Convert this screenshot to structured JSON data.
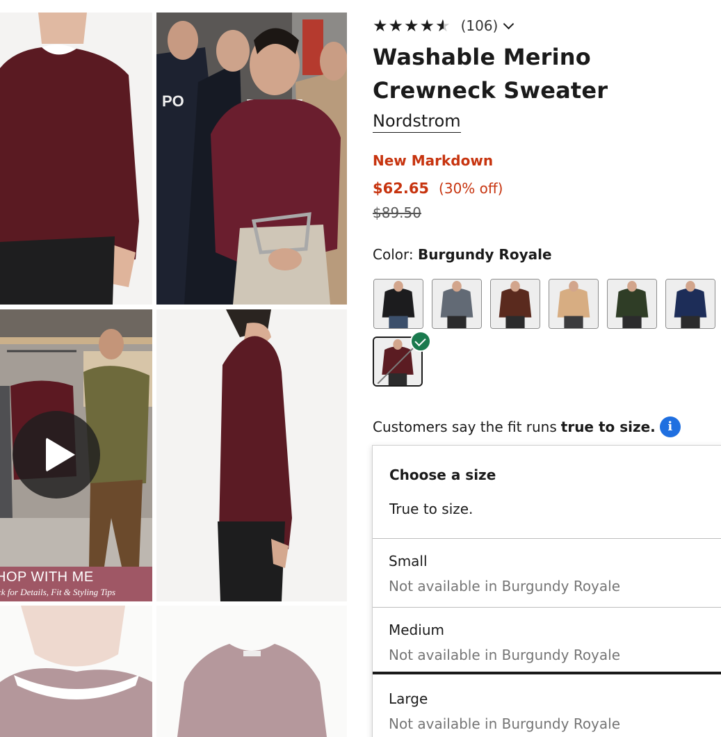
{
  "product": {
    "rating_stars": "★★★★",
    "rating_value": 4.5,
    "review_count": "(106)",
    "title": "Washable Merino Crewneck Sweater",
    "brand": "Nordstrom",
    "badge": "New Markdown",
    "sale_price": "$62.65",
    "discount": "(30% off)",
    "original_price": "$89.50"
  },
  "color": {
    "label": "Color:",
    "selected": "Burgundy Royale",
    "swatches": [
      {
        "name": "black",
        "hex": "#1c1c1e"
      },
      {
        "name": "grey",
        "hex": "#626a75"
      },
      {
        "name": "rust-brown",
        "hex": "#5a2a1e"
      },
      {
        "name": "camel",
        "hex": "#d7ad82"
      },
      {
        "name": "olive",
        "hex": "#2f3d26"
      },
      {
        "name": "navy",
        "hex": "#1d2d58"
      },
      {
        "name": "burgundy",
        "hex": "#5b1c22"
      }
    ]
  },
  "fit": {
    "prefix": "Customers say the fit runs",
    "emphasis": "true to size.",
    "info_glyph": "i"
  },
  "size_menu": {
    "heading": "Choose a size",
    "subheading": "True to size.",
    "options": [
      {
        "name": "Small",
        "status": "Not available in Burgundy Royale"
      },
      {
        "name": "Medium",
        "status": "Not available in Burgundy Royale"
      },
      {
        "name": "Large",
        "status": "Not available in Burgundy Royale"
      }
    ]
  },
  "gallery": {
    "video_banner_title": "HOP WITH ME",
    "video_banner_subtitle": "ck for Details, Fit & Styling Tips",
    "police_jacket_text": "PO"
  },
  "colors": {
    "sale_red": "#c7340f",
    "sweater_burgundy": "#5b1c22",
    "check_green": "#1a7a4e",
    "info_blue": "#1f6fe0"
  }
}
